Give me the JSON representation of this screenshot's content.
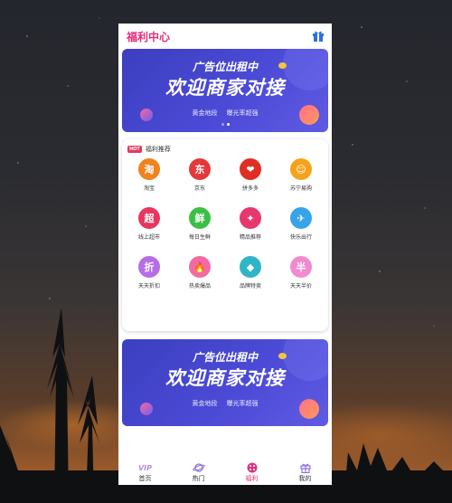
{
  "header": {
    "title": "福利中心"
  },
  "banner": {
    "line1": "广告位出租中",
    "line2": "欢迎商家对接",
    "tag1": "黄金地段",
    "tag2": "曝光率超强"
  },
  "section": {
    "badge": "HOT",
    "title": "福利推荐"
  },
  "shortcuts": [
    {
      "label": "淘宝",
      "glyph": "淘",
      "color": "#f2821e"
    },
    {
      "label": "京东",
      "glyph": "东",
      "color": "#e4393c"
    },
    {
      "label": "拼多多",
      "glyph": "❤",
      "color": "#e02e24"
    },
    {
      "label": "苏宁易购",
      "glyph": "☺",
      "color": "#f7a21b"
    },
    {
      "label": "线上超市",
      "glyph": "超",
      "color": "#e8365d"
    },
    {
      "label": "每日生鲜",
      "glyph": "鲜",
      "color": "#3cbf45"
    },
    {
      "label": "精品推荐",
      "glyph": "✦",
      "color": "#e8366e"
    },
    {
      "label": "快乐出行",
      "glyph": "✈",
      "color": "#37a3e8"
    },
    {
      "label": "天天折扣",
      "glyph": "折",
      "color": "#b66de8"
    },
    {
      "label": "热卖爆品",
      "glyph": "🔥",
      "color": "#f26aa5"
    },
    {
      "label": "品牌特卖",
      "glyph": "◆",
      "color": "#2fb5c8"
    },
    {
      "label": "天天半价",
      "glyph": "半",
      "color": "#f28ad0"
    }
  ],
  "tabs": [
    {
      "label": "首页",
      "icon": "vip-icon"
    },
    {
      "label": "热门",
      "icon": "planet-icon"
    },
    {
      "label": "福利",
      "icon": "dots-icon"
    },
    {
      "label": "我的",
      "icon": "gift-icon"
    }
  ],
  "colors": {
    "accent": "#e0307a",
    "banner": "#4b4ad6"
  }
}
